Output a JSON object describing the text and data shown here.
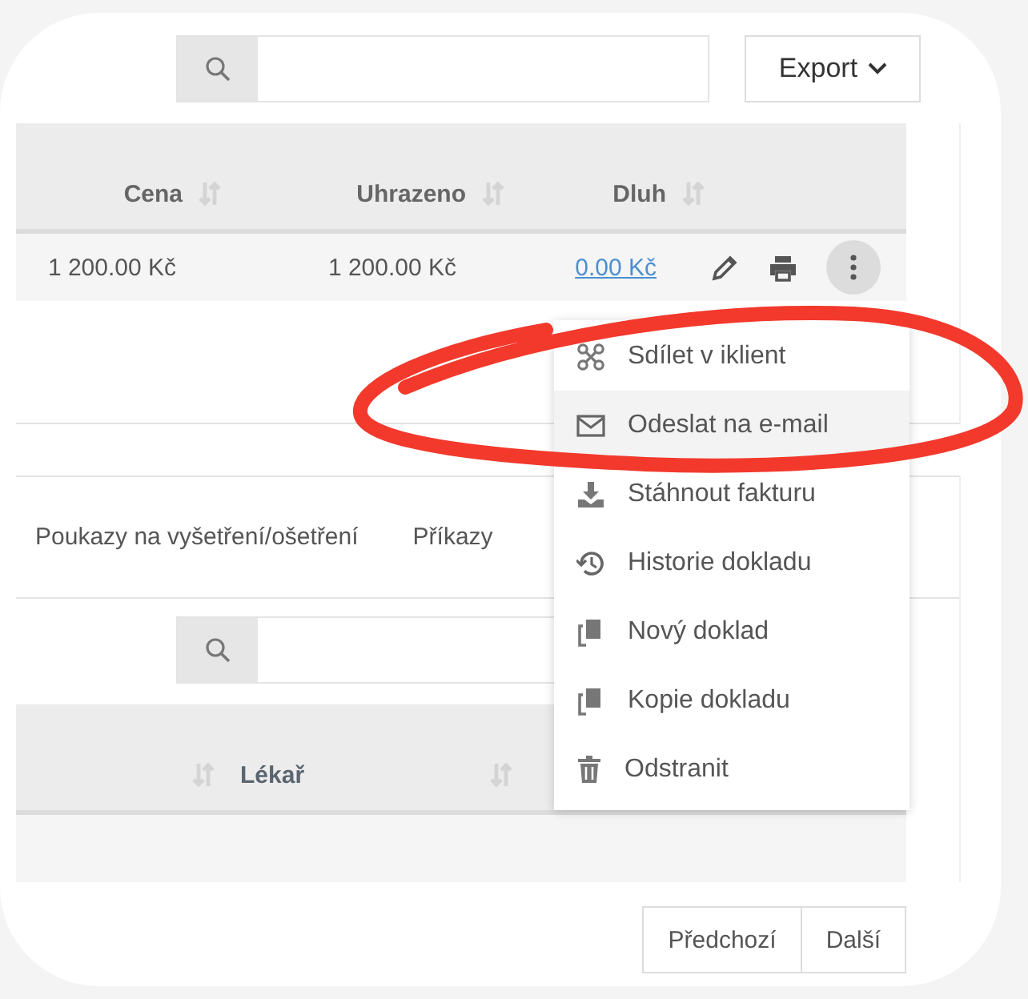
{
  "toolbar": {
    "export_button": "Export"
  },
  "invoice_table": {
    "columns": [
      "Cena",
      "Uhrazeno",
      "Dluh"
    ],
    "rows": [
      {
        "cena": "1 200.00 Kč",
        "uhrazeno": "1 200.00 Kč",
        "dluh": "0.00 Kč"
      }
    ]
  },
  "tabs": [
    {
      "label": "Poukazy na vyšetření/ošetření"
    },
    {
      "label": "Příkazy"
    }
  ],
  "second_table": {
    "columns": [
      "Lékař"
    ]
  },
  "pagination": [
    "Předchozí",
    "Další"
  ],
  "action_menu": {
    "items": [
      {
        "kind": "share",
        "label": "Sdílet v iklient",
        "selected": false
      },
      {
        "kind": "email",
        "label": "Odeslat na e-mail",
        "selected": true
      },
      {
        "kind": "download",
        "label": "Stáhnout fakturu",
        "selected": false
      },
      {
        "kind": "history",
        "label": "Historie dokladu",
        "selected": false
      },
      {
        "kind": "new",
        "label": "Nový doklad",
        "selected": false
      },
      {
        "kind": "copy",
        "label": "Kopie dokladu",
        "selected": false
      },
      {
        "kind": "delete",
        "label": "Odstranit",
        "selected": false
      }
    ]
  }
}
